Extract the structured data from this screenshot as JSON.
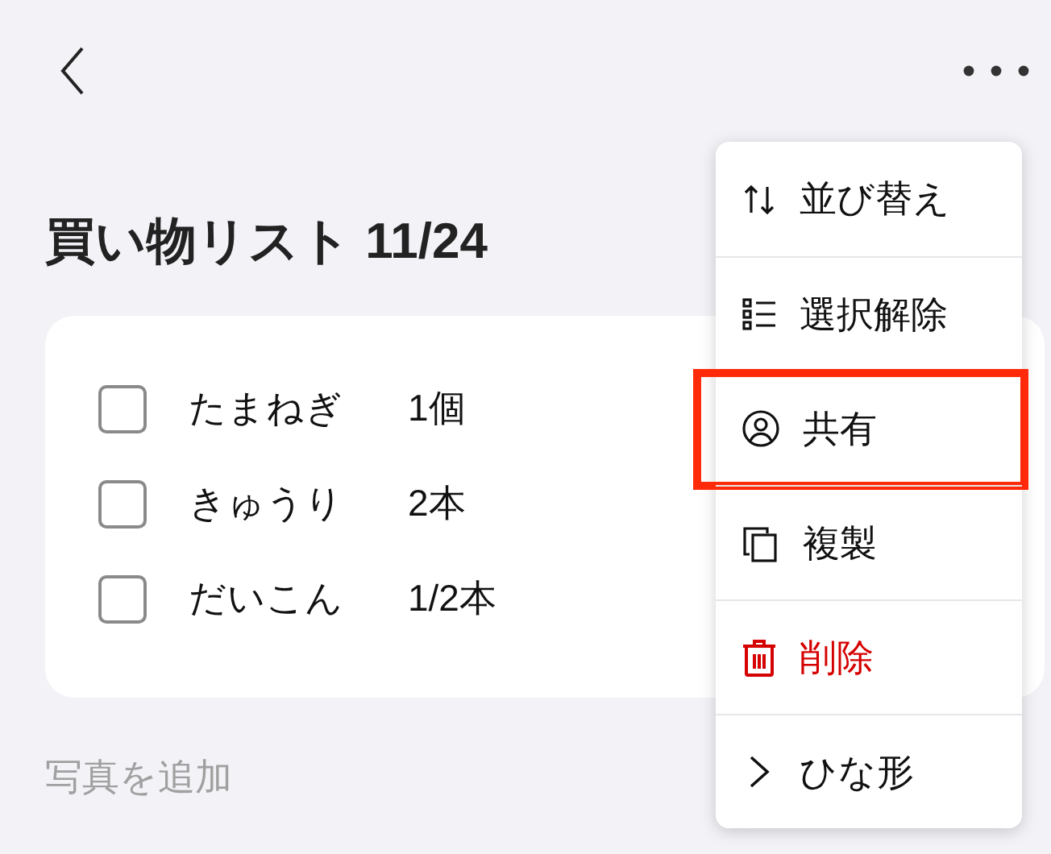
{
  "title": "買い物リスト 11/24",
  "items": [
    {
      "name": "たまねぎ",
      "quantity": "1個",
      "checked": false
    },
    {
      "name": "きゅうり",
      "quantity": "2本",
      "checked": false
    },
    {
      "name": "だいこん",
      "quantity": "1/2本",
      "checked": false
    }
  ],
  "add_photo": "写真を追加",
  "menu": [
    {
      "label": "並び替え",
      "destructive": false,
      "highlighted": false
    },
    {
      "label": "選択解除",
      "destructive": false,
      "highlighted": false
    },
    {
      "label": "共有",
      "destructive": false,
      "highlighted": true
    },
    {
      "label": "複製",
      "destructive": false,
      "highlighted": false
    },
    {
      "label": "削除",
      "destructive": true,
      "highlighted": false
    },
    {
      "label": "ひな形",
      "destructive": false,
      "highlighted": false
    }
  ]
}
